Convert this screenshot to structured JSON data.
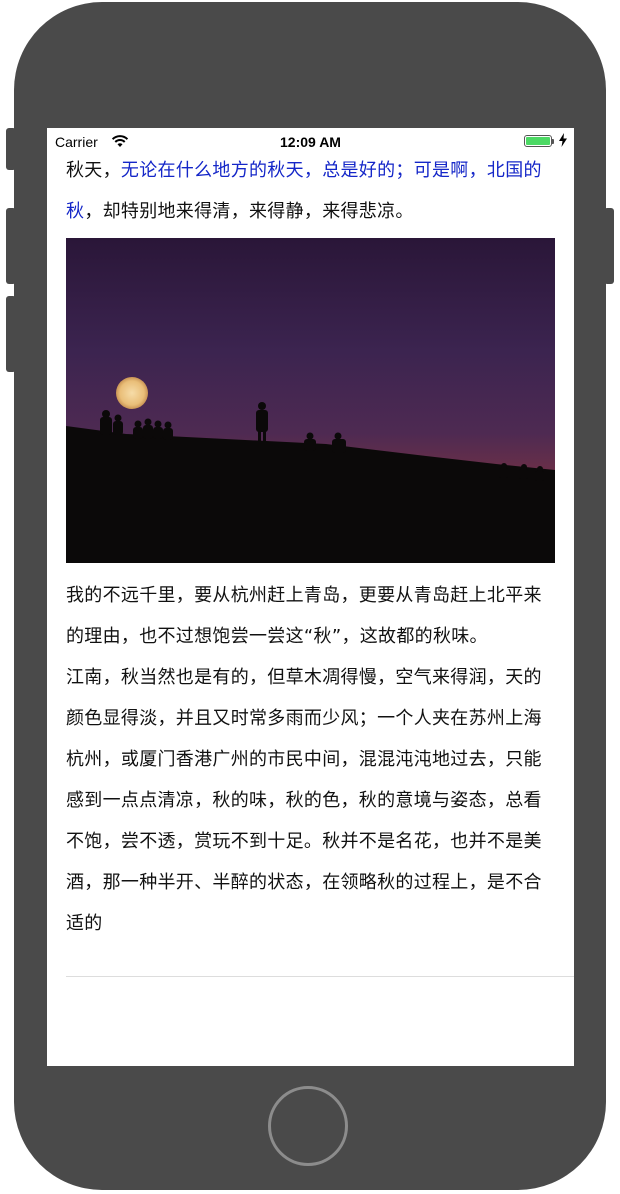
{
  "status_bar": {
    "carrier": "Carrier",
    "time": "12:09 AM",
    "wifi_icon": "wifi-icon",
    "battery_icon": "battery-icon",
    "charging_icon": "bolt-icon",
    "battery_color": "#4cd964"
  },
  "article": {
    "p1_plain_start": "秋天，",
    "p1_link": "无论在什么地方的秋天，总是好的；可是啊，北国的秋",
    "p1_plain_end": "，却特别地来得清，来得静，来得悲凉。",
    "link_color": "#1426c8",
    "image_icon": "moon-silhouette-photo",
    "p2": "我的不远千里，要从杭州赶上青岛，更要从青岛赶上北平来的理由，也不过想饱尝一尝这“秋”，这故都的秋味。",
    "p3": "江南，秋当然也是有的，但草木凋得慢，空气来得润，天的颜色显得淡，并且又时常多雨而少风；一个人夹在苏州上海杭州，或厦门香港广州的市民中间，混混沌沌地过去，只能感到一点点清凉，秋的味，秋的色，秋的意境与姿态，总看不饱，尝不透，赏玩不到十足。秋并不是名花，也并不是美酒，那一种半开、半醉的状态，在领略秋的过程上，是不合适的"
  },
  "device": {
    "frame_color": "#4a4a4a",
    "home_button_icon": "home-button"
  }
}
